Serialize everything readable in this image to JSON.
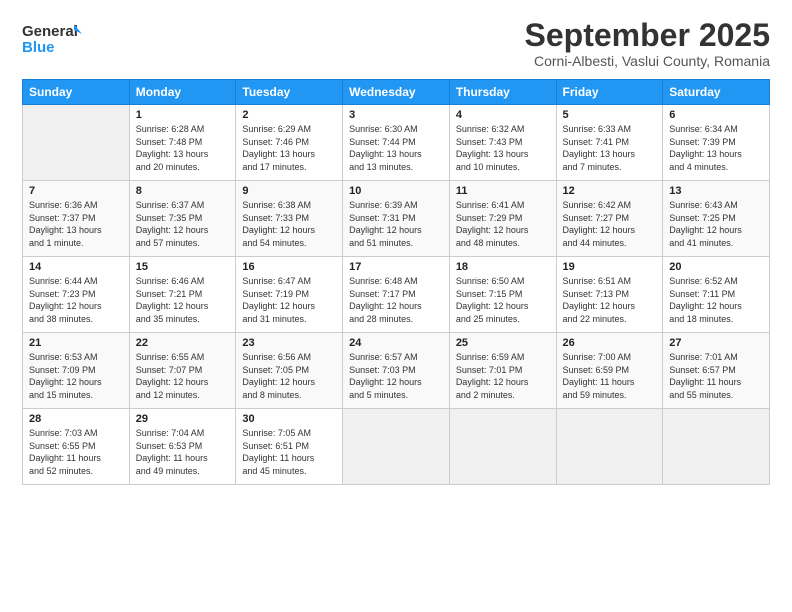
{
  "logo": {
    "line1": "General",
    "line2": "Blue"
  },
  "header": {
    "month": "September 2025",
    "location": "Corni-Albesti, Vaslui County, Romania"
  },
  "weekdays": [
    "Sunday",
    "Monday",
    "Tuesday",
    "Wednesday",
    "Thursday",
    "Friday",
    "Saturday"
  ],
  "weeks": [
    [
      {
        "day": "",
        "info": ""
      },
      {
        "day": "1",
        "info": "Sunrise: 6:28 AM\nSunset: 7:48 PM\nDaylight: 13 hours\nand 20 minutes."
      },
      {
        "day": "2",
        "info": "Sunrise: 6:29 AM\nSunset: 7:46 PM\nDaylight: 13 hours\nand 17 minutes."
      },
      {
        "day": "3",
        "info": "Sunrise: 6:30 AM\nSunset: 7:44 PM\nDaylight: 13 hours\nand 13 minutes."
      },
      {
        "day": "4",
        "info": "Sunrise: 6:32 AM\nSunset: 7:43 PM\nDaylight: 13 hours\nand 10 minutes."
      },
      {
        "day": "5",
        "info": "Sunrise: 6:33 AM\nSunset: 7:41 PM\nDaylight: 13 hours\nand 7 minutes."
      },
      {
        "day": "6",
        "info": "Sunrise: 6:34 AM\nSunset: 7:39 PM\nDaylight: 13 hours\nand 4 minutes."
      }
    ],
    [
      {
        "day": "7",
        "info": "Sunrise: 6:36 AM\nSunset: 7:37 PM\nDaylight: 13 hours\nand 1 minute."
      },
      {
        "day": "8",
        "info": "Sunrise: 6:37 AM\nSunset: 7:35 PM\nDaylight: 12 hours\nand 57 minutes."
      },
      {
        "day": "9",
        "info": "Sunrise: 6:38 AM\nSunset: 7:33 PM\nDaylight: 12 hours\nand 54 minutes."
      },
      {
        "day": "10",
        "info": "Sunrise: 6:39 AM\nSunset: 7:31 PM\nDaylight: 12 hours\nand 51 minutes."
      },
      {
        "day": "11",
        "info": "Sunrise: 6:41 AM\nSunset: 7:29 PM\nDaylight: 12 hours\nand 48 minutes."
      },
      {
        "day": "12",
        "info": "Sunrise: 6:42 AM\nSunset: 7:27 PM\nDaylight: 12 hours\nand 44 minutes."
      },
      {
        "day": "13",
        "info": "Sunrise: 6:43 AM\nSunset: 7:25 PM\nDaylight: 12 hours\nand 41 minutes."
      }
    ],
    [
      {
        "day": "14",
        "info": "Sunrise: 6:44 AM\nSunset: 7:23 PM\nDaylight: 12 hours\nand 38 minutes."
      },
      {
        "day": "15",
        "info": "Sunrise: 6:46 AM\nSunset: 7:21 PM\nDaylight: 12 hours\nand 35 minutes."
      },
      {
        "day": "16",
        "info": "Sunrise: 6:47 AM\nSunset: 7:19 PM\nDaylight: 12 hours\nand 31 minutes."
      },
      {
        "day": "17",
        "info": "Sunrise: 6:48 AM\nSunset: 7:17 PM\nDaylight: 12 hours\nand 28 minutes."
      },
      {
        "day": "18",
        "info": "Sunrise: 6:50 AM\nSunset: 7:15 PM\nDaylight: 12 hours\nand 25 minutes."
      },
      {
        "day": "19",
        "info": "Sunrise: 6:51 AM\nSunset: 7:13 PM\nDaylight: 12 hours\nand 22 minutes."
      },
      {
        "day": "20",
        "info": "Sunrise: 6:52 AM\nSunset: 7:11 PM\nDaylight: 12 hours\nand 18 minutes."
      }
    ],
    [
      {
        "day": "21",
        "info": "Sunrise: 6:53 AM\nSunset: 7:09 PM\nDaylight: 12 hours\nand 15 minutes."
      },
      {
        "day": "22",
        "info": "Sunrise: 6:55 AM\nSunset: 7:07 PM\nDaylight: 12 hours\nand 12 minutes."
      },
      {
        "day": "23",
        "info": "Sunrise: 6:56 AM\nSunset: 7:05 PM\nDaylight: 12 hours\nand 8 minutes."
      },
      {
        "day": "24",
        "info": "Sunrise: 6:57 AM\nSunset: 7:03 PM\nDaylight: 12 hours\nand 5 minutes."
      },
      {
        "day": "25",
        "info": "Sunrise: 6:59 AM\nSunset: 7:01 PM\nDaylight: 12 hours\nand 2 minutes."
      },
      {
        "day": "26",
        "info": "Sunrise: 7:00 AM\nSunset: 6:59 PM\nDaylight: 11 hours\nand 59 minutes."
      },
      {
        "day": "27",
        "info": "Sunrise: 7:01 AM\nSunset: 6:57 PM\nDaylight: 11 hours\nand 55 minutes."
      }
    ],
    [
      {
        "day": "28",
        "info": "Sunrise: 7:03 AM\nSunset: 6:55 PM\nDaylight: 11 hours\nand 52 minutes."
      },
      {
        "day": "29",
        "info": "Sunrise: 7:04 AM\nSunset: 6:53 PM\nDaylight: 11 hours\nand 49 minutes."
      },
      {
        "day": "30",
        "info": "Sunrise: 7:05 AM\nSunset: 6:51 PM\nDaylight: 11 hours\nand 45 minutes."
      },
      {
        "day": "",
        "info": ""
      },
      {
        "day": "",
        "info": ""
      },
      {
        "day": "",
        "info": ""
      },
      {
        "day": "",
        "info": ""
      }
    ]
  ]
}
